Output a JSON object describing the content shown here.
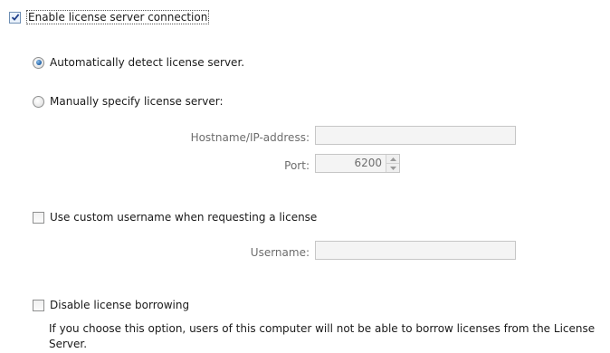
{
  "enable_connection": {
    "label": "Enable license server connection",
    "checked": true
  },
  "auto_detect": {
    "label": "Automatically detect license server.",
    "selected": true
  },
  "manual": {
    "label": "Manually specify license server:",
    "selected": false
  },
  "hostname": {
    "label": "Hostname/IP-address:",
    "value": ""
  },
  "port": {
    "label": "Port:",
    "value": "6200"
  },
  "custom_username": {
    "label": "Use custom username when requesting a license",
    "checked": false
  },
  "username": {
    "label": "Username:",
    "value": ""
  },
  "disable_borrowing": {
    "label": "Disable license borrowing",
    "checked": false,
    "description": "If you choose this option, users of this computer will not be able to borrow licenses from the License Server."
  }
}
